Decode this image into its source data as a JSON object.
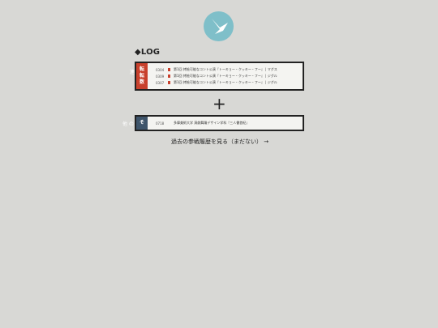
{
  "logo": {
    "icon": "bird-icon",
    "color": "#7fbfc9"
  },
  "log": {
    "title": "◆LOG",
    "featured": {
      "outer_label": "連",
      "label_chars": [
        "転",
        "転",
        "数"
      ],
      "rows": [
        {
          "date": "0304",
          "text": "第1回 拷絵可能なコント公演『トーキョー・クッキー・フー』 | マグス"
        },
        {
          "date": "0309",
          "text": "第1回 拷絵可能なコント公演『トーキョー・クッキー・フー』 | ジグル"
        },
        {
          "date": "0307",
          "text": "第1回 拷絵可能なコント公演『トーキョー・クッキー・フー』 | ジグル"
        }
      ]
    },
    "plus": "+",
    "other": {
      "outer_label": "他 の",
      "label_char": "そ",
      "rows": [
        {
          "date": "0718",
          "text": "多摩美術大学 演劇舞踊デザイン学科『三人書首紀』"
        }
      ]
    },
    "more_link": "過去の参戦履歴を見る（まだない） →"
  }
}
